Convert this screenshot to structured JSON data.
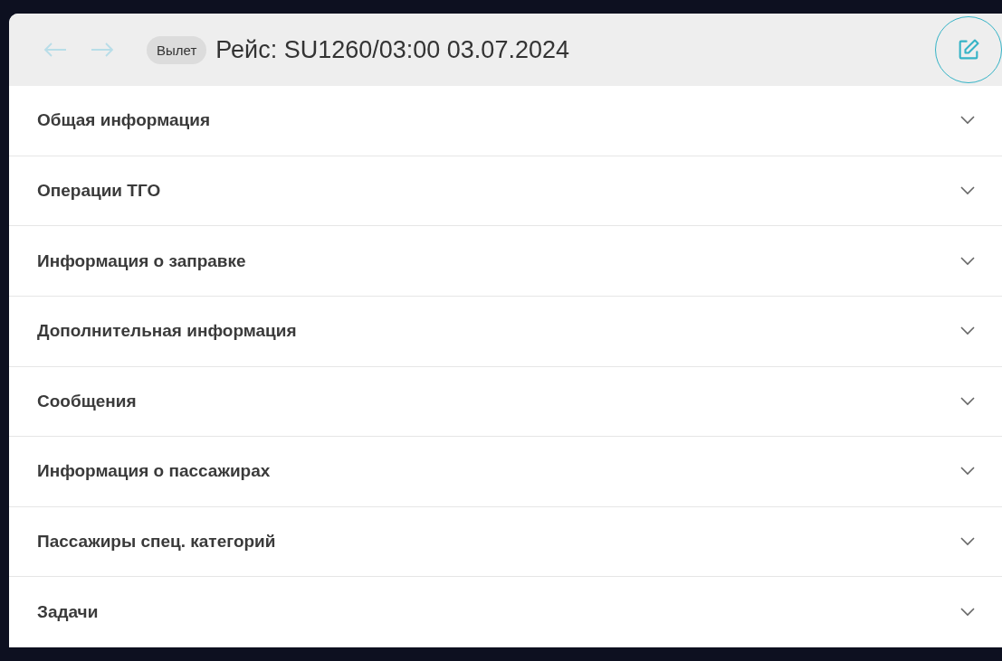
{
  "header": {
    "nav_buttons": [
      {
        "kind": "back",
        "disabled": true
      },
      {
        "kind": "forward",
        "disabled": true
      }
    ],
    "badge": "Вылет",
    "title": "Рейс: SU1260/03:00 03.07.2024"
  },
  "sections": [
    {
      "label": "Общая информация",
      "expanded": false
    },
    {
      "label": "Операции ТГО",
      "expanded": false
    },
    {
      "label": "Информация о заправке",
      "expanded": false
    },
    {
      "label": "Дополнительная информация",
      "expanded": false
    },
    {
      "label": "Сообщения",
      "expanded": false
    },
    {
      "label": "Информация о пассажирах",
      "expanded": false
    },
    {
      "label": "Пассажиры спец. категорий",
      "expanded": false
    },
    {
      "label": "Задачи",
      "expanded": false
    }
  ]
}
